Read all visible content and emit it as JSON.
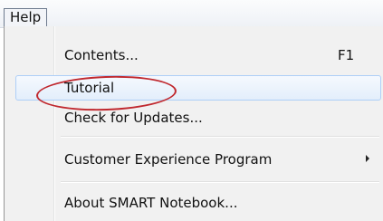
{
  "menubar": {
    "help_label": "Help"
  },
  "menu": {
    "items": [
      {
        "label": "Contents...",
        "shortcut": "F1"
      },
      {
        "label": "Tutorial"
      },
      {
        "label": "Check for Updates..."
      },
      {
        "label": "Customer Experience Program",
        "has_submenu": true
      },
      {
        "label": "About SMART Notebook..."
      }
    ]
  },
  "annotation": {
    "color": "#c0282e"
  }
}
